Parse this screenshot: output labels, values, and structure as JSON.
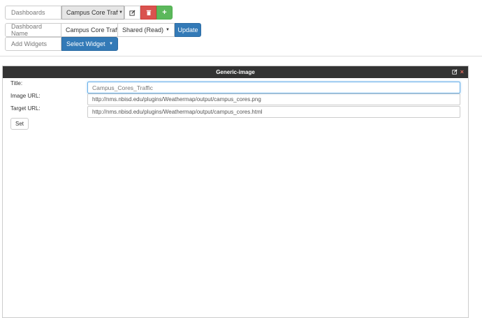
{
  "toolbar": {
    "dashboards_label": "Dashboards",
    "dashboard_selected": "Campus Core Traffic",
    "edit_icon": "edit-icon",
    "delete_icon": "trash-icon",
    "add_icon": "+",
    "dashboard_name_label": "Dashboard Name",
    "dashboard_name_value": "Campus Core Traffi",
    "share_value": "Shared (Read)",
    "update_label": "Update",
    "add_widgets_label": "Add Widgets",
    "select_widget_label": "Select Widget"
  },
  "widget": {
    "title": "Generic-image",
    "edit_icon": "edit-icon",
    "close_icon": "×",
    "title_label": "Title:",
    "title_value": "Campus_Cores_Traffic",
    "image_url_label": "Image URL:",
    "image_url_value": "http://nms.nbisd.edu/plugins/Weathermap/output/campus_cores.png",
    "target_url_label": "Target URL:",
    "target_url_value": "http://nms.nbisd.edu/plugins/Weathermap/output/campus_cores.html",
    "set_label": "Set"
  }
}
